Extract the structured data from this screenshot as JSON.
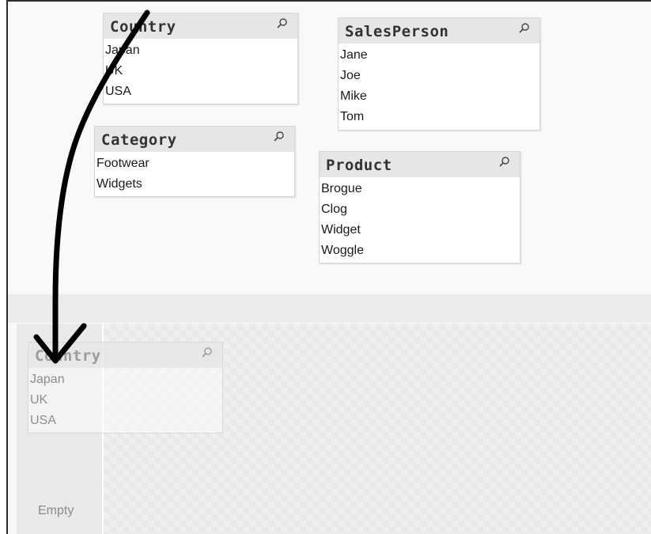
{
  "listboxes": [
    {
      "title": "Country",
      "items": [
        "Japan",
        "UK",
        "USA"
      ]
    },
    {
      "title": "SalesPerson",
      "items": [
        "Jane",
        "Joe",
        "Mike",
        "Tom"
      ]
    },
    {
      "title": "Category",
      "items": [
        "Footwear",
        "Widgets"
      ]
    },
    {
      "title": "Product",
      "items": [
        "Brogue",
        "Clog",
        "Widget",
        "Woggle"
      ]
    }
  ],
  "ghost_listbox": {
    "title": "Country",
    "items": [
      "Japan",
      "UK",
      "USA"
    ]
  },
  "drop_zone": {
    "empty_label": "Empty"
  },
  "icons": {
    "search": "search-icon",
    "drag_arrow": "drag-arrow-icon"
  },
  "colors": {
    "caption_bg": "#e6e6e6",
    "arrow": "#000000"
  }
}
